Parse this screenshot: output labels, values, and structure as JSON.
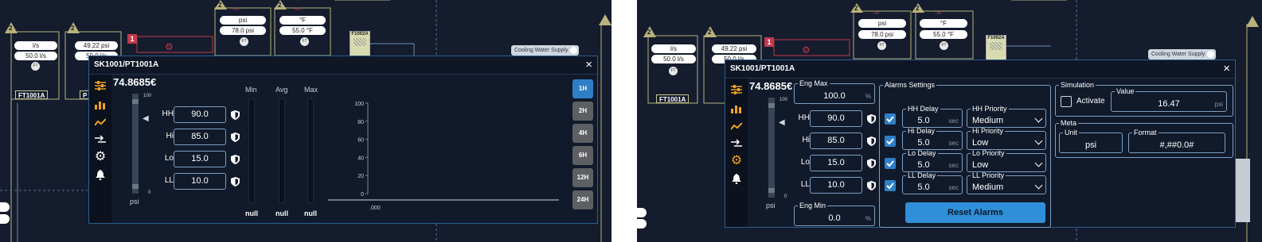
{
  "colors": {
    "background": "#141c2e",
    "accent": "#2f7fc7",
    "icon_orange": "#f0a020",
    "warning_red": "#c23a4b",
    "olive_line": "#b9b27a"
  },
  "diagram": {
    "warning_badge": "2",
    "alarm_badge": "1",
    "ft_tag": "FT",
    "unit_ls": "l/s",
    "flow_value": "50.0 l/s",
    "pressure_value": "49.22 psi",
    "unit_psi": "psi",
    "psi_value": "78.0 psi",
    "unit_f": "°F",
    "temp_value": "55.0 °F",
    "flow_tag_label": "FT1001A",
    "second_label_initial": "P",
    "tank_label": "F1002A",
    "cooling_label": "Cooling Water Supply",
    "x_mark": "-×-"
  },
  "dialog_left": {
    "title": "SK1001/PT1001A",
    "value": "74.8685€",
    "scale_top": "100",
    "scale_bottom": "0",
    "unit": "psi",
    "limits": [
      {
        "label": "HH",
        "value": "90.0"
      },
      {
        "label": "Hi",
        "value": "85.0"
      },
      {
        "label": "Lo",
        "value": "15.0"
      },
      {
        "label": "LL",
        "value": "10.0"
      }
    ],
    "stats": [
      {
        "label": "Min",
        "value": "null"
      },
      {
        "label": "Avg",
        "value": "null"
      },
      {
        "label": "Max",
        "value": "null"
      }
    ],
    "time_buttons": [
      "1H",
      "2H",
      "4H",
      "6H",
      "12H",
      "24H"
    ],
    "active_time": "1H",
    "chart_data": {
      "type": "line",
      "series": [],
      "y_ticks": [
        "100",
        "80",
        "60",
        "40",
        "20",
        "0"
      ],
      "x_ticks": [
        ".000"
      ],
      "ylim": [
        0,
        100
      ],
      "grid": false
    }
  },
  "dialog_right": {
    "title": "SK1001/PT1001A",
    "value": "74.8685€",
    "scale_top": "100",
    "scale_bottom": "0",
    "unit": "psi",
    "limits": [
      {
        "label": "HH",
        "value": "90.0"
      },
      {
        "label": "Hi",
        "value": "85.0"
      },
      {
        "label": "Lo",
        "value": "15.0"
      },
      {
        "label": "LL",
        "value": "10.0"
      }
    ],
    "eng_max": {
      "legend": "Eng Max",
      "value": "100.0",
      "unit": "%"
    },
    "eng_min": {
      "legend": "Eng Min",
      "value": "0.0",
      "unit": "%"
    },
    "alarms": {
      "legend": "Alarms Settings",
      "rows": [
        {
          "delay_legend": "HH Delay",
          "delay": "5.0",
          "delay_unit": "sec",
          "priority_legend": "HH Priority",
          "priority": "Medium",
          "checked": true
        },
        {
          "delay_legend": "Hi Delay",
          "delay": "5.0",
          "delay_unit": "sec",
          "priority_legend": "Hi Priority",
          "priority": "Low",
          "checked": true
        },
        {
          "delay_legend": "Lo Delay",
          "delay": "5.0",
          "delay_unit": "sec",
          "priority_legend": "Lo Priority",
          "priority": "Low",
          "checked": true
        },
        {
          "delay_legend": "LL Delay",
          "delay": "5.0",
          "delay_unit": "sec",
          "priority_legend": "LL Priority",
          "priority": "Medium",
          "checked": true
        }
      ],
      "reset_label": "Reset Alarms"
    },
    "simulation": {
      "legend": "Simulation",
      "activate_label": "Activate",
      "activate_checked": false,
      "value_legend": "Value",
      "value": "16.47",
      "value_unit": "psi"
    },
    "meta": {
      "legend": "Meta",
      "unit_legend": "Unit",
      "unit": "psi",
      "format_legend": "Format",
      "format": "#,##0.0#"
    }
  }
}
